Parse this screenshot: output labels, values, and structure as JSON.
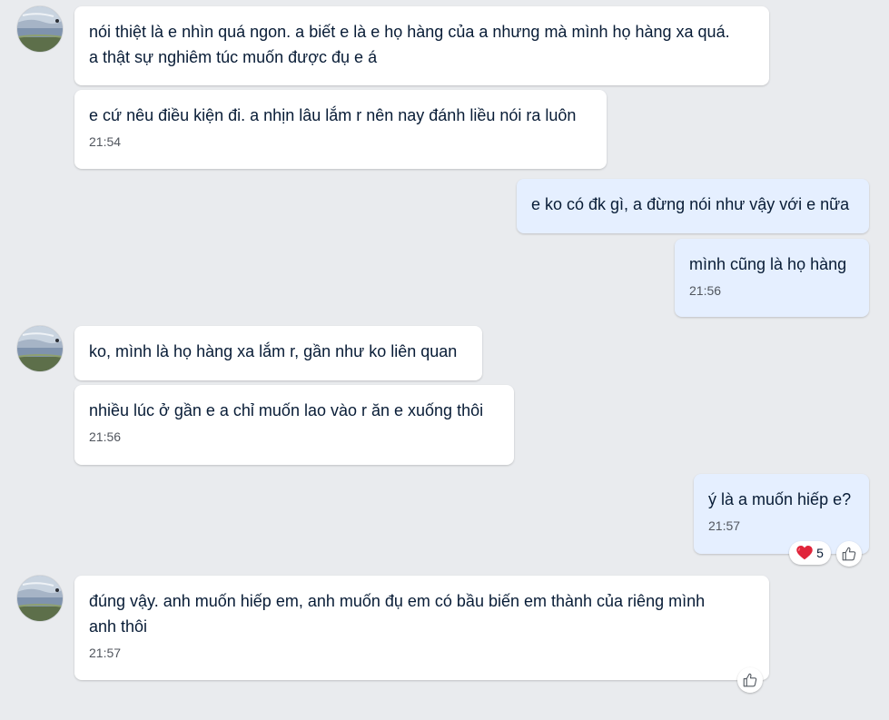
{
  "colors": {
    "background": "#e9ebee",
    "incoming_bubble": "#ffffff",
    "outgoing_bubble": "#e5efff",
    "text": "#081c36",
    "timestamp": "#51565e",
    "heart": "#e0243a"
  },
  "messages": [
    {
      "sender": "contact",
      "text": "nói thiệt là e nhìn quá ngon. a biết e là e họ hàng của a nhưng mà mình họ hàng xa quá.\na thật sự nghiêm túc muốn được đụ e á",
      "time": ""
    },
    {
      "sender": "contact",
      "text": "e cứ nêu điều kiện đi. a nhịn lâu lắm r nên nay đánh liều nói ra luôn",
      "time": "21:54"
    },
    {
      "sender": "me",
      "text": "e ko có đk gì, a đừng nói như vậy với e nữa",
      "time": ""
    },
    {
      "sender": "me",
      "text": "mình cũng là họ hàng",
      "time": "21:56"
    },
    {
      "sender": "contact",
      "text": "ko, mình là họ hàng xa lắm r, gần như ko liên quan",
      "time": ""
    },
    {
      "sender": "contact",
      "text": "nhiều lúc ở gần e a chỉ muốn lao vào r ăn e xuống thôi",
      "time": "21:56"
    },
    {
      "sender": "me",
      "text": "ý là a muốn hiếp e?",
      "time": "21:57",
      "reaction": {
        "icon": "heart-icon",
        "count": "5"
      },
      "react_button_icon": "thumbs-up-icon"
    },
    {
      "sender": "contact",
      "text": "đúng vậy. anh muốn hiếp em, anh muốn đụ em có bầu biến em thành của riêng mình\nanh thôi",
      "time": "21:57",
      "react_button_icon": "thumbs-up-icon"
    }
  ]
}
